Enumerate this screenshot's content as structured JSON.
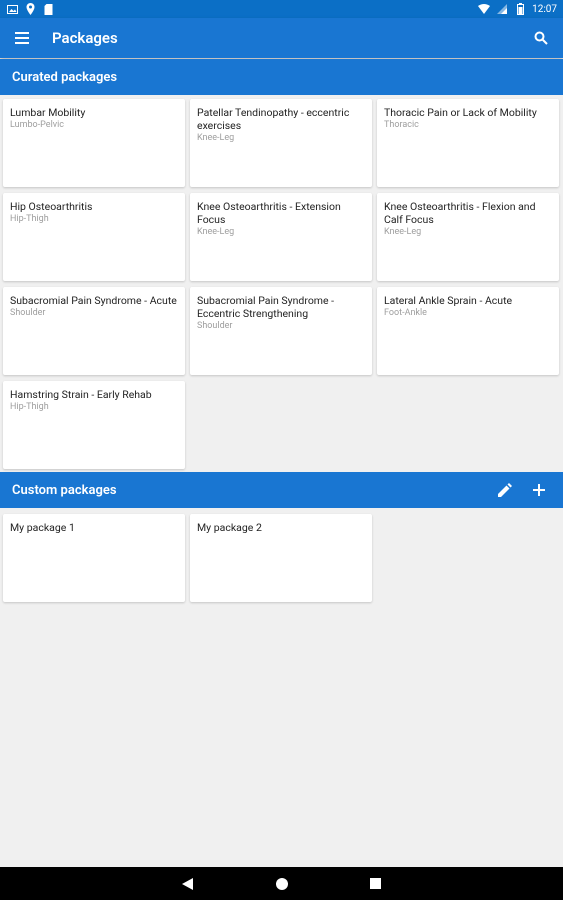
{
  "status_bar": {
    "time": "12:07"
  },
  "app_bar": {
    "title": "Packages",
    "menu_icon": "hamburger-menu-icon",
    "search_icon": "search-icon"
  },
  "curated": {
    "header": "Curated packages",
    "items": [
      {
        "title": "Lumbar Mobility",
        "subtitle": "Lumbo-Pelvic"
      },
      {
        "title": "Patellar Tendinopathy  - eccentric exercises",
        "subtitle": "Knee-Leg"
      },
      {
        "title": "Thoracic Pain or Lack of Mobility",
        "subtitle": "Thoracic"
      },
      {
        "title": "Hip Osteoarthritis",
        "subtitle": "Hip-Thigh"
      },
      {
        "title": "Knee Osteoarthritis - Extension Focus",
        "subtitle": "Knee-Leg"
      },
      {
        "title": "Knee Osteoarthritis - Flexion and Calf Focus",
        "subtitle": "Knee-Leg"
      },
      {
        "title": "Subacromial Pain Syndrome - Acute",
        "subtitle": "Shoulder"
      },
      {
        "title": "Subacromial Pain Syndrome - Eccentric Strengthening",
        "subtitle": "Shoulder"
      },
      {
        "title": "Lateral Ankle Sprain - Acute",
        "subtitle": "Foot-Ankle"
      },
      {
        "title": "Hamstring Strain - Early Rehab",
        "subtitle": "Hip-Thigh"
      }
    ]
  },
  "custom": {
    "header": "Custom packages",
    "edit_icon": "pencil-edit-icon",
    "add_icon": "plus-add-icon",
    "items": [
      {
        "title": "My package 1"
      },
      {
        "title": "My package 2"
      }
    ]
  },
  "nav_bar": {
    "back_icon": "back-triangle-icon",
    "home_icon": "home-circle-icon",
    "recents_icon": "recents-square-icon"
  }
}
